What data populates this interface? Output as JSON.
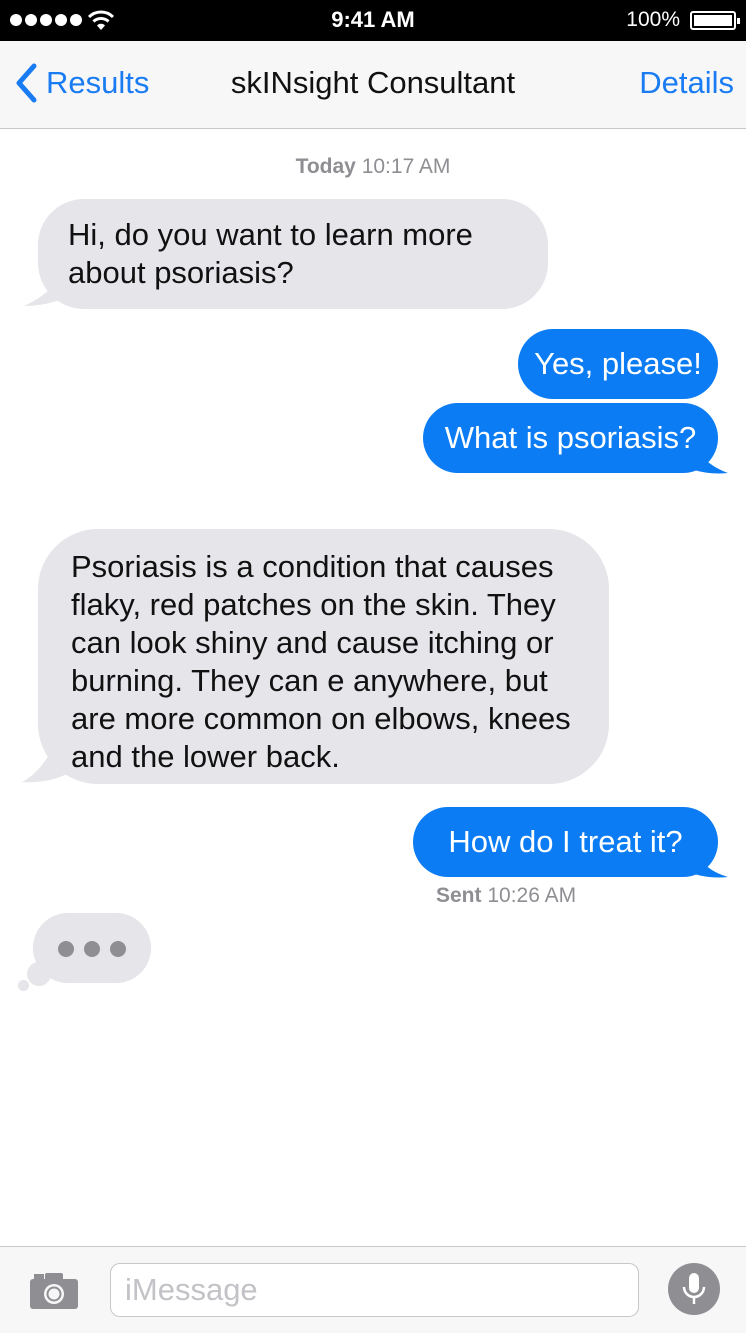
{
  "status_bar": {
    "time": "9:41 AM",
    "battery_percent": "100%",
    "signal_icon": "signal-dots-icon",
    "wifi_icon": "wifi-icon",
    "battery_icon": "battery-icon"
  },
  "nav": {
    "back_label": "Results",
    "back_icon": "chevron-left-icon",
    "title": "skINsight Consultant",
    "details_label": "Details"
  },
  "thread": {
    "timestamp_top": {
      "day": "Today",
      "time": "10:17 AM"
    },
    "messages": [
      {
        "direction": "incoming",
        "text": "Hi, do you want to learn more about psoriasis?"
      },
      {
        "direction": "outgoing",
        "text": "Yes, please!"
      },
      {
        "direction": "outgoing",
        "text": "What is psoriasis?"
      },
      {
        "direction": "incoming",
        "text": "Psoriasis is a condition that causes flaky, red patches on the skin. They can look shiny and cause itching or burning. They can e anywhere, but are more common on elbows, knees and the lower back."
      },
      {
        "direction": "outgoing",
        "text": "How do I treat it?"
      }
    ],
    "sent_receipt": {
      "label": "Sent",
      "time": "10:26 AM"
    },
    "typing_indicator_icon": "typing-dots-icon"
  },
  "input_bar": {
    "camera_icon": "camera-icon",
    "placeholder": "iMessage",
    "mic_icon": "microphone-icon"
  },
  "colors": {
    "accent": "#1a7cf2",
    "outgoing_bubble": "#0b7cf3",
    "incoming_bubble": "#e5e5ea",
    "meta_text": "#8e8e93"
  }
}
